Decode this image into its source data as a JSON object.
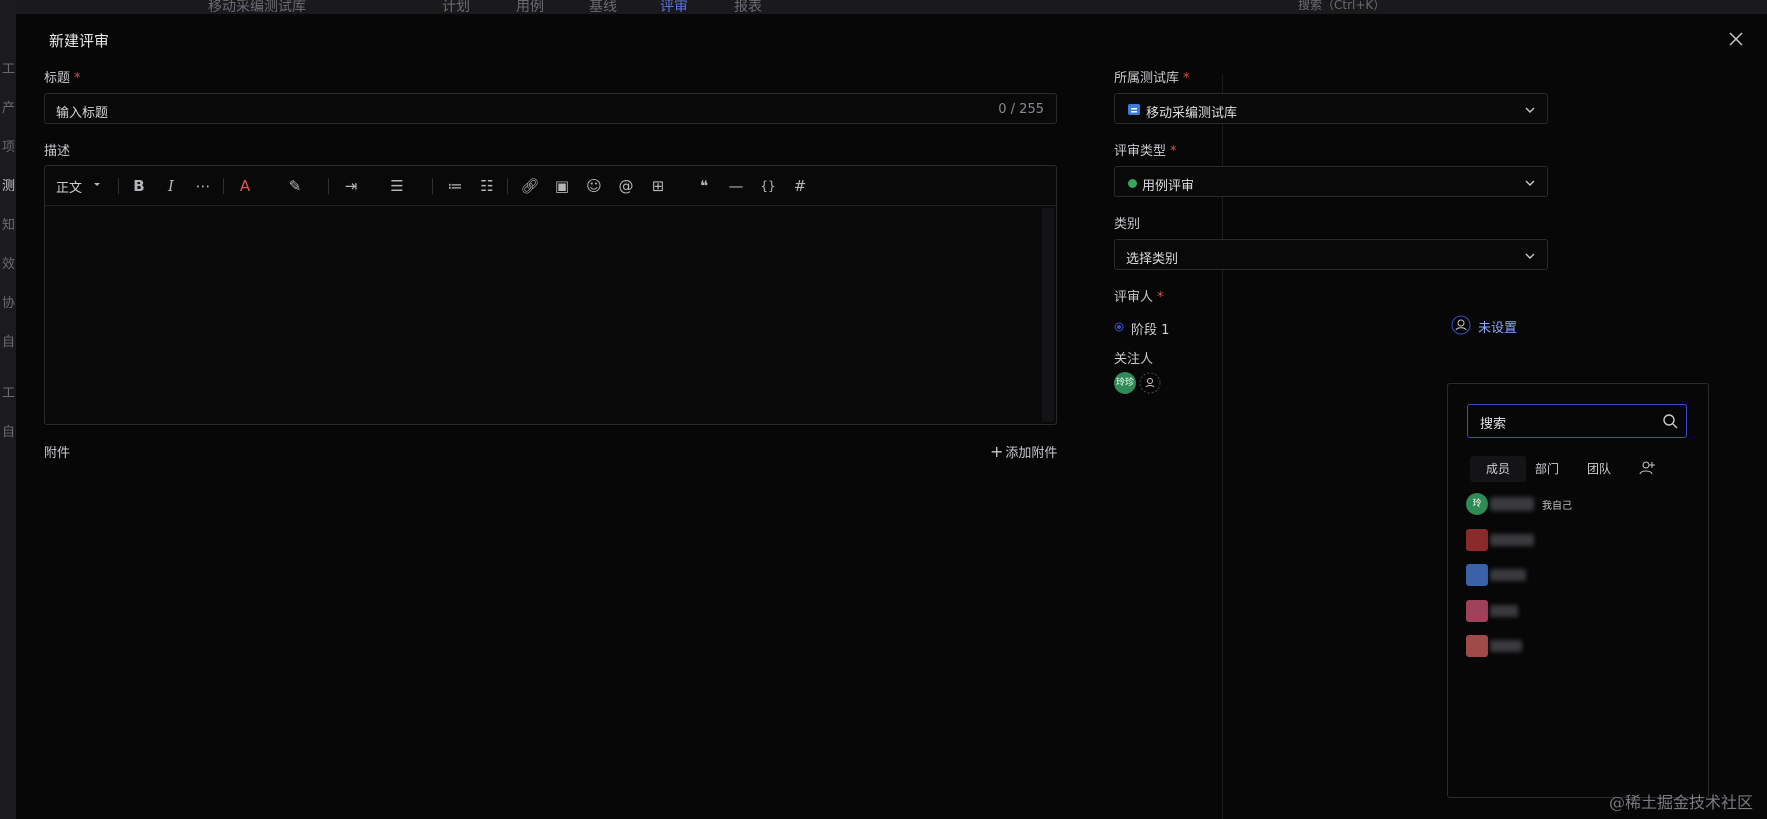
{
  "background_nav": {
    "project": "移动采编测试库",
    "tabs": [
      "计划",
      "用例",
      "基线",
      "评审",
      "报表"
    ],
    "search_placeholder": "搜索（Ctrl+K）"
  },
  "left_rail": [
    "工",
    "产",
    "项",
    "测",
    "知",
    "效",
    "协",
    "自",
    "工",
    "自"
  ],
  "modal": {
    "title": "新建评审",
    "title_field": {
      "label": "标题",
      "placeholder": "输入标题",
      "counter": "0 / 255"
    },
    "description": {
      "label": "描述",
      "paragraph_style": "正文"
    },
    "attachments": {
      "label": "附件",
      "add": "添加附件"
    },
    "library": {
      "label": "所属测试库",
      "value": "移动采编测试库"
    },
    "review_type": {
      "label": "评审类型",
      "value": "用例评审",
      "color": "#35a55b"
    },
    "category": {
      "label": "类别",
      "placeholder": "选择类别"
    },
    "reviewer": {
      "label": "评审人",
      "stage": "阶段 1",
      "unset": "未设置"
    },
    "watcher": {
      "label": "关注人",
      "avatar_text": "玲珍"
    }
  },
  "picker": {
    "search_placeholder": "搜索",
    "tabs": [
      "成员",
      "部门",
      "团队"
    ],
    "members": [
      {
        "avatar_text": "玲",
        "tag": "我自己"
      }
    ]
  },
  "watermark": "@稀土掘金技术社区",
  "colors": {
    "accent": "#3a4cc8",
    "required": "#e05050",
    "success": "#35a55b",
    "link": "#8fa6ff"
  }
}
